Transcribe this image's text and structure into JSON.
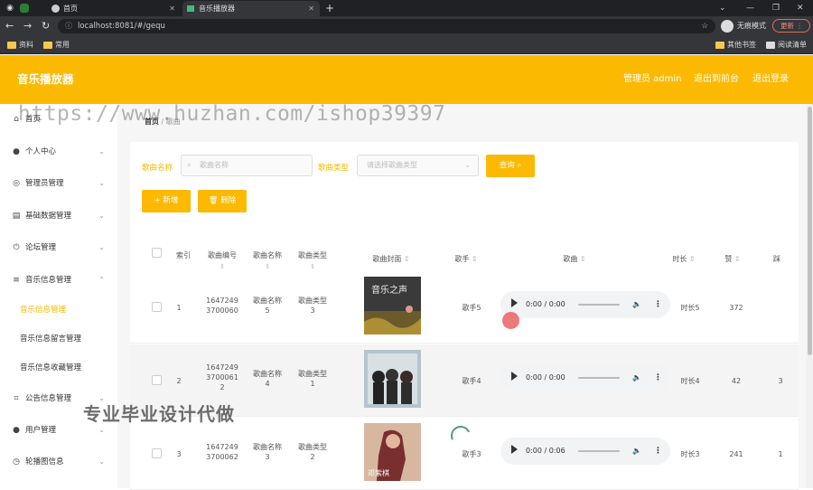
{
  "browser": {
    "tabs": [
      {
        "label": "首页"
      },
      {
        "label": "音乐播放器"
      }
    ],
    "url": "localhost:8081/#/gequ",
    "profile_label": "无痕模式",
    "update_label": "更新",
    "bookmarks": [
      "资料",
      "常用"
    ],
    "other_bookmarks": "其他书签",
    "reading_list": "阅读清单"
  },
  "header": {
    "title": "音乐播放器",
    "user": "管理员 admin",
    "back_link": "退出到前台",
    "logout_link": "退出登录",
    "brand_color": "#fbb902"
  },
  "sidebar": {
    "items": [
      {
        "label": "首页",
        "icon": "home-icon"
      },
      {
        "label": "个人中心",
        "icon": "user-icon"
      },
      {
        "label": "管理员管理",
        "icon": "compass-icon"
      },
      {
        "label": "基础数据管理",
        "icon": "database-icon"
      },
      {
        "label": "论坛管理",
        "icon": "power-icon"
      },
      {
        "label": "音乐信息管理",
        "icon": "menu-icon"
      }
    ],
    "sub_items": [
      "音乐信息管理",
      "音乐信息留言管理",
      "音乐信息收藏管理"
    ],
    "items_after": [
      {
        "label": "公告信息管理",
        "icon": "crop-icon"
      },
      {
        "label": "用户管理",
        "icon": "user-icon"
      },
      {
        "label": "轮播图信息",
        "icon": "clock-icon"
      }
    ]
  },
  "breadcrumb": {
    "root": "首页",
    "current": "歌曲"
  },
  "search": {
    "name_label": "歌曲名称",
    "name_placeholder": "歌曲名称",
    "type_label": "歌曲类型",
    "type_placeholder": "请选择歌曲类型",
    "query_button": "查询"
  },
  "actions": {
    "add": "新增",
    "delete": "删除"
  },
  "table": {
    "headers": [
      "索引",
      "歌曲编号",
      "歌曲名称",
      "歌曲类型",
      "歌曲封面",
      "歌手",
      "歌曲",
      "时长",
      "赞",
      "踩"
    ],
    "rows": [
      {
        "index": "1",
        "code_a": "1647249",
        "code_b": "3700060",
        "code_c": "",
        "name_a": "歌曲名称",
        "name_b": "5",
        "type_a": "歌曲类型",
        "type_b": "3",
        "singer": "歌手5",
        "time": "0:00 / 0:00",
        "duration": "时长5",
        "likes": "372",
        "dislikes": ""
      },
      {
        "index": "2",
        "code_a": "1647249",
        "code_b": "3700061",
        "code_c": "2",
        "name_a": "歌曲名称",
        "name_b": "4",
        "type_a": "歌曲类型",
        "type_b": "1",
        "singer": "歌手4",
        "time": "0:00 / 0:00",
        "duration": "时长4",
        "likes": "42",
        "dislikes": "3"
      },
      {
        "index": "3",
        "code_a": "1647249",
        "code_b": "3700062",
        "code_c": "",
        "name_a": "歌曲名称",
        "name_b": "3",
        "type_a": "歌曲类型",
        "type_b": "2",
        "singer": "歌手3",
        "time": "0:00 / 0:06",
        "duration": "时长3",
        "likes": "241",
        "dislikes": "1"
      }
    ]
  },
  "cover_texts": [
    "音乐之声",
    "",
    "邓紫棋"
  ],
  "watermarks": {
    "url_mark": "https://www.huzhan.com/ishop39397",
    "promo": "专业毕业设计代做"
  }
}
